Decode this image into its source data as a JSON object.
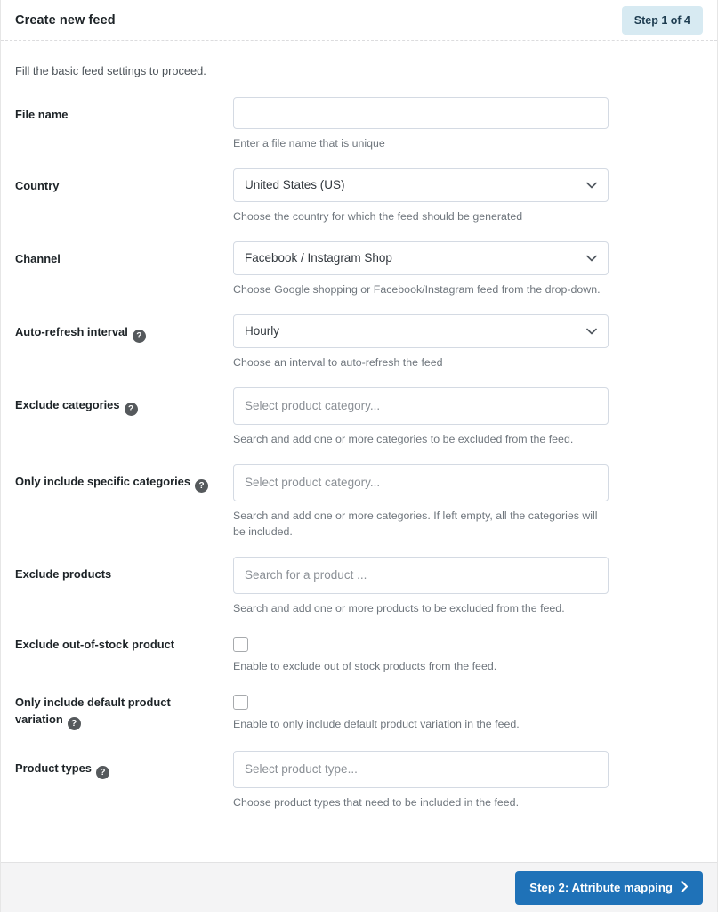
{
  "header": {
    "title": "Create new feed",
    "step_badge": "Step 1 of 4"
  },
  "body": {
    "intro": "Fill the basic feed settings to proceed."
  },
  "fields": {
    "file_name": {
      "label": "File name",
      "value": "",
      "placeholder": "",
      "hint": "Enter a file name that is unique"
    },
    "country": {
      "label": "Country",
      "value": "United States (US)",
      "hint": "Choose the country for which the feed should be generated"
    },
    "channel": {
      "label": "Channel",
      "value": "Facebook / Instagram Shop",
      "hint": "Choose Google shopping or Facebook/Instagram feed from the drop-down."
    },
    "auto_refresh": {
      "label": "Auto-refresh interval",
      "help": "?",
      "value": "Hourly",
      "hint": "Choose an interval to auto-refresh the feed"
    },
    "exclude_categories": {
      "label": "Exclude categories",
      "help": "?",
      "placeholder": "Select product category...",
      "hint": "Search and add one or more categories to be excluded from the feed."
    },
    "include_categories": {
      "label": "Only include specific categories",
      "help": "?",
      "placeholder": "Select product category...",
      "hint": "Search and add one or more categories. If left empty, all the categories will be included."
    },
    "exclude_products": {
      "label": "Exclude products",
      "placeholder": "Search for a product ...",
      "hint": "Search and add one or more products to be excluded from the feed."
    },
    "exclude_out_of_stock": {
      "label": "Exclude out-of-stock product",
      "checked": false,
      "hint": "Enable to exclude out of stock products from the feed."
    },
    "default_variation_only": {
      "label": "Only include default product variation",
      "help": "?",
      "checked": false,
      "hint": "Enable to only include default product variation in the feed."
    },
    "product_types": {
      "label": "Product types",
      "help": "?",
      "placeholder": "Select product type...",
      "hint": "Choose product types that need to be included in the feed."
    }
  },
  "footer": {
    "next_label": "Step 2: Attribute mapping"
  },
  "colors": {
    "accent": "#1f72b8",
    "badge_bg": "#d7eaf2",
    "badge_text": "#1d3c50",
    "hint_text": "#6f767d",
    "footer_bg": "#f4f4f5"
  }
}
